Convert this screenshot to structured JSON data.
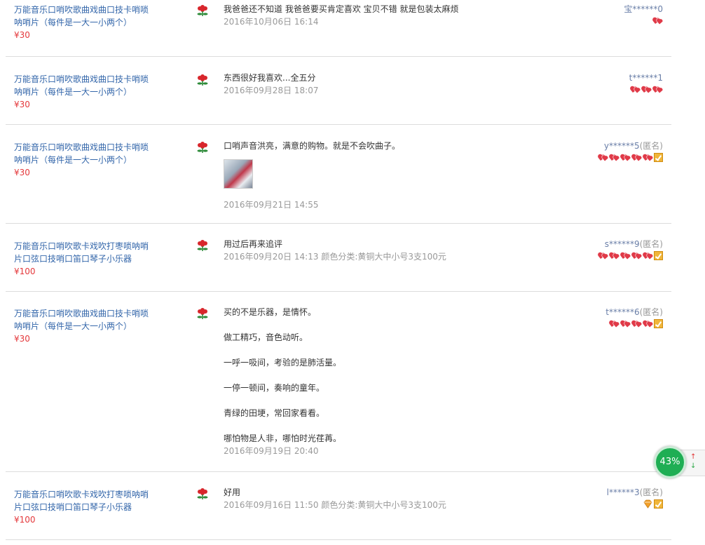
{
  "reviews": [
    {
      "title": "万能音乐口哨吹歌曲戏曲口技卡哨唢呐哨片（每件是一大一小两个）",
      "price": "¥30",
      "text": "我爸爸还不知道 我爸爸要买肯定喜欢 宝贝不错 就是包装太麻烦",
      "date": "2016年10月06日 16:14",
      "sku": "",
      "user": "宝******0",
      "anon": "",
      "has_image": false,
      "badges": [
        "heart"
      ]
    },
    {
      "title": "万能音乐口哨吹歌曲戏曲口技卡哨唢呐哨片（每件是一大一小两个）",
      "price": "¥30",
      "text": "东西很好我喜欢...全五分",
      "date": "2016年09月28日 18:07",
      "sku": "",
      "user": "t******1",
      "anon": "",
      "has_image": false,
      "badges": [
        "heart",
        "heart",
        "heart"
      ]
    },
    {
      "title": "万能音乐口哨吹歌曲戏曲口技卡哨唢呐哨片（每件是一大一小两个）",
      "price": "¥30",
      "text": "口哨声音洪亮，满意的购物。就是不会吹曲子。",
      "date": "2016年09月21日 14:55",
      "sku": "",
      "user": "y******5",
      "anon": "(匿名)",
      "has_image": true,
      "badges": [
        "heart",
        "heart",
        "heart",
        "heart",
        "heart",
        "vip"
      ]
    },
    {
      "title": "万能音乐口哨吹歌卡戏吹打枣唢呐哨片口弦口技哨口笛口琴子小乐器",
      "price": "¥100",
      "text": "用过后再来追评",
      "date": "2016年09月20日 14:13",
      "sku": "颜色分类:黄铜大中小号3支100元",
      "user": "s******9",
      "anon": "(匿名)",
      "has_image": false,
      "badges": [
        "heart",
        "heart",
        "heart",
        "heart",
        "heart",
        "vip"
      ]
    },
    {
      "title": "万能音乐口哨吹歌曲戏曲口技卡哨唢呐哨片（每件是一大一小两个）",
      "price": "¥30",
      "text": "买的不是乐器，是情怀。\n\n做工精巧，音色动听。\n\n一呼一吸间，考验的是肺活量。\n\n一停一顿间，奏响的童年。\n\n青绿的田埂，常回家看看。\n\n哪怕物是人非，哪怕时光荏苒。",
      "date": "2016年09月19日 20:40",
      "sku": "",
      "user": "t******6",
      "anon": "(匿名)",
      "has_image": false,
      "badges": [
        "heart",
        "heart",
        "heart",
        "heart",
        "vip"
      ]
    },
    {
      "title": "万能音乐口哨吹歌卡戏吹打枣唢呐哨片口弦口技哨口笛口琴子小乐器",
      "price": "¥100",
      "text": "好用",
      "date": "2016年09月16日 11:50",
      "sku": "颜色分类:黄铜大中小号3支100元",
      "user": "l******3",
      "anon": "(匿名)",
      "has_image": false,
      "badges": [
        "diamond",
        "vip"
      ]
    }
  ],
  "widget": {
    "percent": "43%",
    "up_arrow": "↑",
    "down_arrow": "↓"
  },
  "colors": {
    "link": "#3366aa",
    "price": "#e4393c",
    "meta": "#999999",
    "heart": "#e03a48",
    "widget": "#1fae54"
  }
}
